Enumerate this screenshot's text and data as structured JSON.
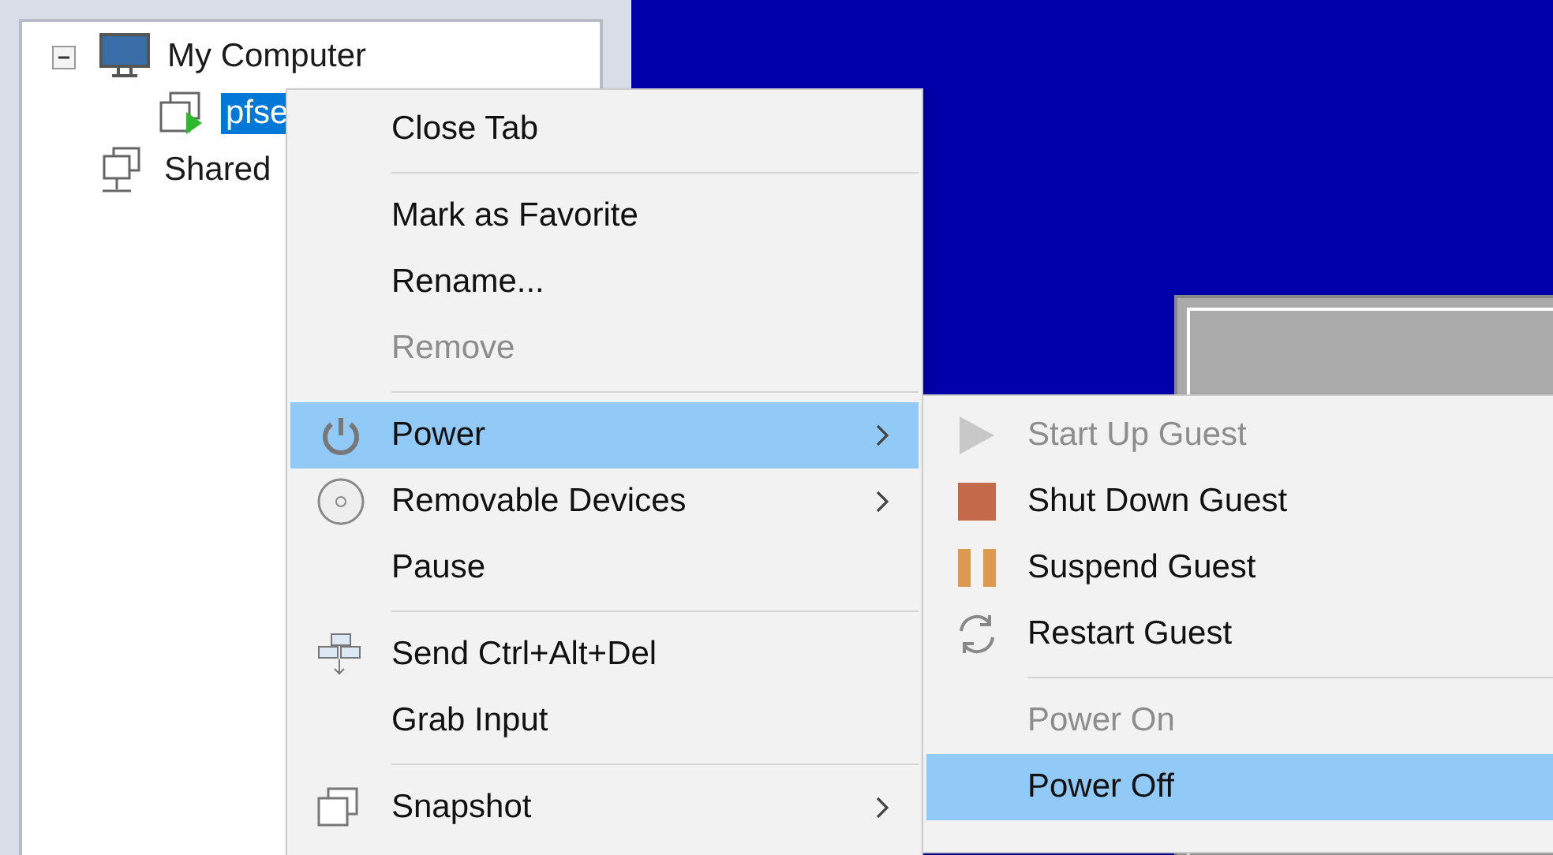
{
  "tree": [
    {
      "label": "My Computer",
      "expanded": true,
      "selected": false,
      "children": [
        {
          "label": "pfse",
          "selected": true
        }
      ]
    },
    {
      "label": "Shared",
      "selected": false
    }
  ],
  "context_menu": {
    "sections": [
      [
        {
          "label": "Close Tab",
          "disabled": false,
          "selected": false,
          "submenu": false
        }
      ],
      [
        {
          "label": "Mark as Favorite",
          "disabled": false,
          "selected": false,
          "submenu": false
        },
        {
          "label": "Rename...",
          "disabled": false,
          "selected": false,
          "submenu": false
        },
        {
          "label": "Remove",
          "disabled": true,
          "selected": false,
          "submenu": false
        }
      ],
      [
        {
          "label": "Power",
          "disabled": false,
          "selected": true,
          "submenu": true
        },
        {
          "label": "Removable Devices",
          "disabled": false,
          "selected": false,
          "submenu": true
        },
        {
          "label": "Pause",
          "disabled": false,
          "selected": false,
          "submenu": false
        }
      ],
      [
        {
          "label": "Send Ctrl+Alt+Del",
          "disabled": false,
          "selected": false,
          "submenu": false
        },
        {
          "label": "Grab Input",
          "disabled": false,
          "selected": false,
          "submenu": false
        }
      ],
      [
        {
          "label": "Snapshot",
          "disabled": false,
          "selected": false,
          "submenu": true
        }
      ]
    ]
  },
  "power_submenu": {
    "sections": [
      [
        {
          "label": "Start Up Guest",
          "disabled": true,
          "selected": false
        },
        {
          "label": "Shut Down Guest",
          "disabled": false,
          "selected": false
        },
        {
          "label": "Suspend Guest",
          "disabled": false,
          "selected": false
        },
        {
          "label": "Restart Guest",
          "disabled": false,
          "selected": false
        }
      ],
      [
        {
          "label": "Power On",
          "disabled": true,
          "selected": false
        },
        {
          "label": "Power Off",
          "disabled": false,
          "selected": true
        }
      ]
    ]
  }
}
